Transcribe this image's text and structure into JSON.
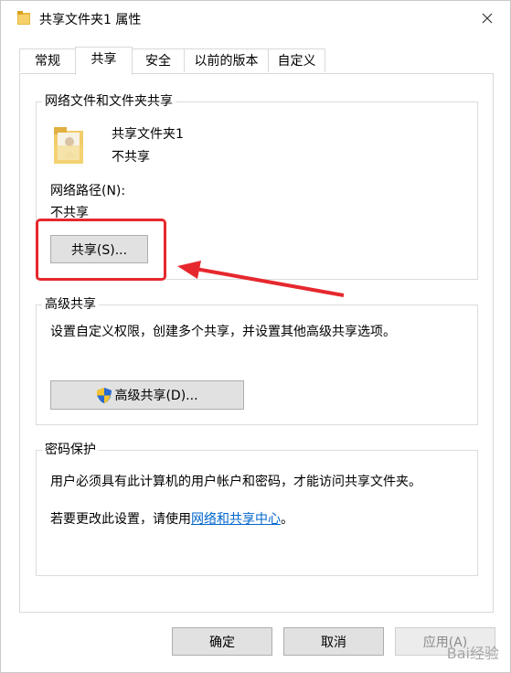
{
  "window": {
    "title": "共享文件夹1 属性"
  },
  "tabs": [
    {
      "label": "常规"
    },
    {
      "label": "共享"
    },
    {
      "label": "安全"
    },
    {
      "label": "以前的版本"
    },
    {
      "label": "自定义"
    }
  ],
  "sharing": {
    "group_title": "网络文件和文件夹共享",
    "folder_name": "共享文件夹1",
    "folder_status": "不共享",
    "network_path_label": "网络路径(N):",
    "network_path_value": "不共享",
    "share_button": "共享(S)..."
  },
  "advanced": {
    "group_title": "高级共享",
    "description": "设置自定义权限，创建多个共享，并设置其他高级共享选项。",
    "button": "高级共享(D)..."
  },
  "password": {
    "group_title": "密码保护",
    "description": "用户必须具有此计算机的用户帐户和密码，才能访问共享文件夹。",
    "change_prefix": "若要更改此设置，请使用",
    "link": "网络和共享中心",
    "change_suffix": "。"
  },
  "footer": {
    "ok": "确定",
    "cancel": "取消",
    "apply": "应用(A)"
  },
  "watermark": "Bai经验",
  "colors": {
    "annotation": "#e6282e",
    "link": "#0066cc"
  }
}
